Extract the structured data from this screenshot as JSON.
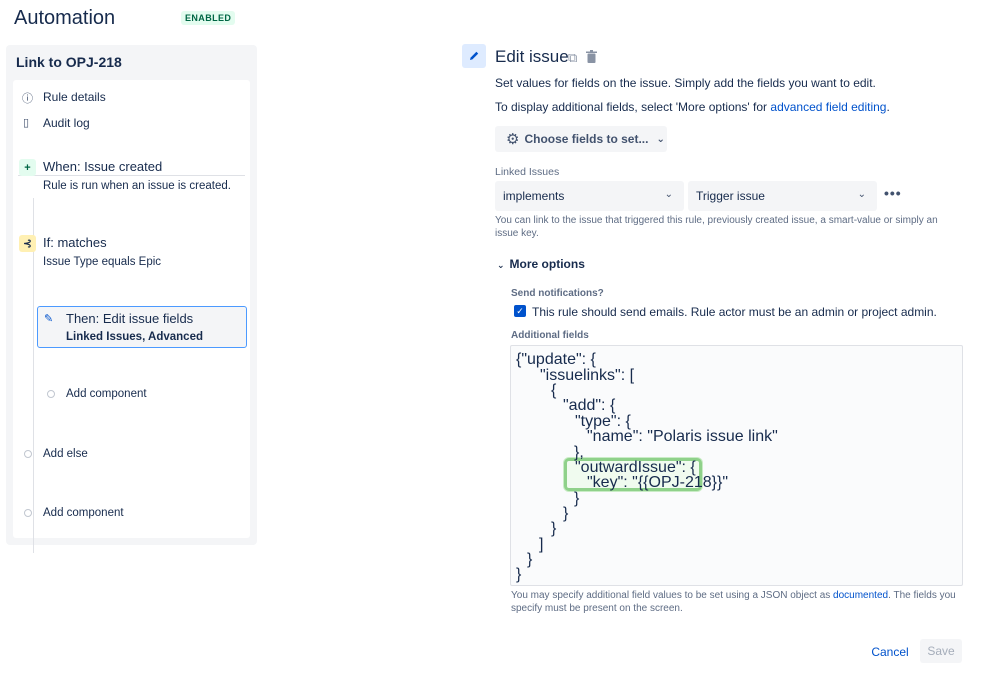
{
  "header": {
    "title": "Automation",
    "status": "ENABLED"
  },
  "sidebar": {
    "rule_name": "Link to OPJ-218",
    "links": [
      "Rule details",
      "Audit log"
    ],
    "when": {
      "title": "When: Issue created",
      "sub": "Rule is run when an issue is created."
    },
    "condition": {
      "title": "If: matches",
      "sub": "Issue Type equals Epic"
    },
    "action": {
      "title": "Then: Edit issue fields",
      "sub_a": "Linked Issues",
      "sub_sep": ", ",
      "sub_b": "Advanced"
    },
    "add_component_inner": "Add component",
    "add_else": "Add else",
    "add_component_outer": "Add component"
  },
  "editor": {
    "title": "Edit issue",
    "desc1": "Set values for fields on the issue. Simply add the fields you want to edit.",
    "desc2_pre": "To display additional fields, select 'More options' for ",
    "desc2_link": "advanced field editing",
    "desc2_post": ".",
    "choose_fields": "Choose fields to set...",
    "linked_label": "Linked Issues",
    "link_type": "implements",
    "link_target": "Trigger issue",
    "linked_hint": "You can link to the issue that triggered this rule, previously created issue, a smart-value or simply an issue key.",
    "more_options": "More options",
    "send_notif_label": "Send notifications?",
    "send_notif_text": "This rule should send emails. Rule actor must be an admin or project admin.",
    "send_notif_checked": true,
    "additional_label": "Additional fields",
    "code_lines": [
      "{\"update\": {",
      "\"issuelinks\": [",
      "{",
      "\"add\": {",
      "\"type\": {",
      "\"name\": \"Polaris issue link\"",
      "},",
      "\"outwardIssue\": {",
      "\"key\": \"{{OPJ-218}}\"",
      "}",
      "}",
      "}",
      "]",
      "}",
      "}"
    ],
    "footer_hint_pre": "You may specify additional field values to be set using a JSON object as ",
    "footer_hint_link": "documented",
    "footer_hint_post": ". The fields you specify must be present on the screen.",
    "cancel": "Cancel",
    "save": "Save"
  },
  "colors": {
    "accent": "#0052cc",
    "highlight": "#8fd18a",
    "when_icon_bg": "#e3fcef",
    "if_icon_bg": "#fff0b3",
    "then_border": "#4c9aff"
  },
  "icons": [
    "info-icon",
    "document-icon",
    "plus-icon",
    "branch-icon",
    "pencil-icon",
    "copy-icon",
    "trash-icon",
    "gear-icon",
    "chevron-down-icon",
    "more-icon",
    "check-icon"
  ]
}
